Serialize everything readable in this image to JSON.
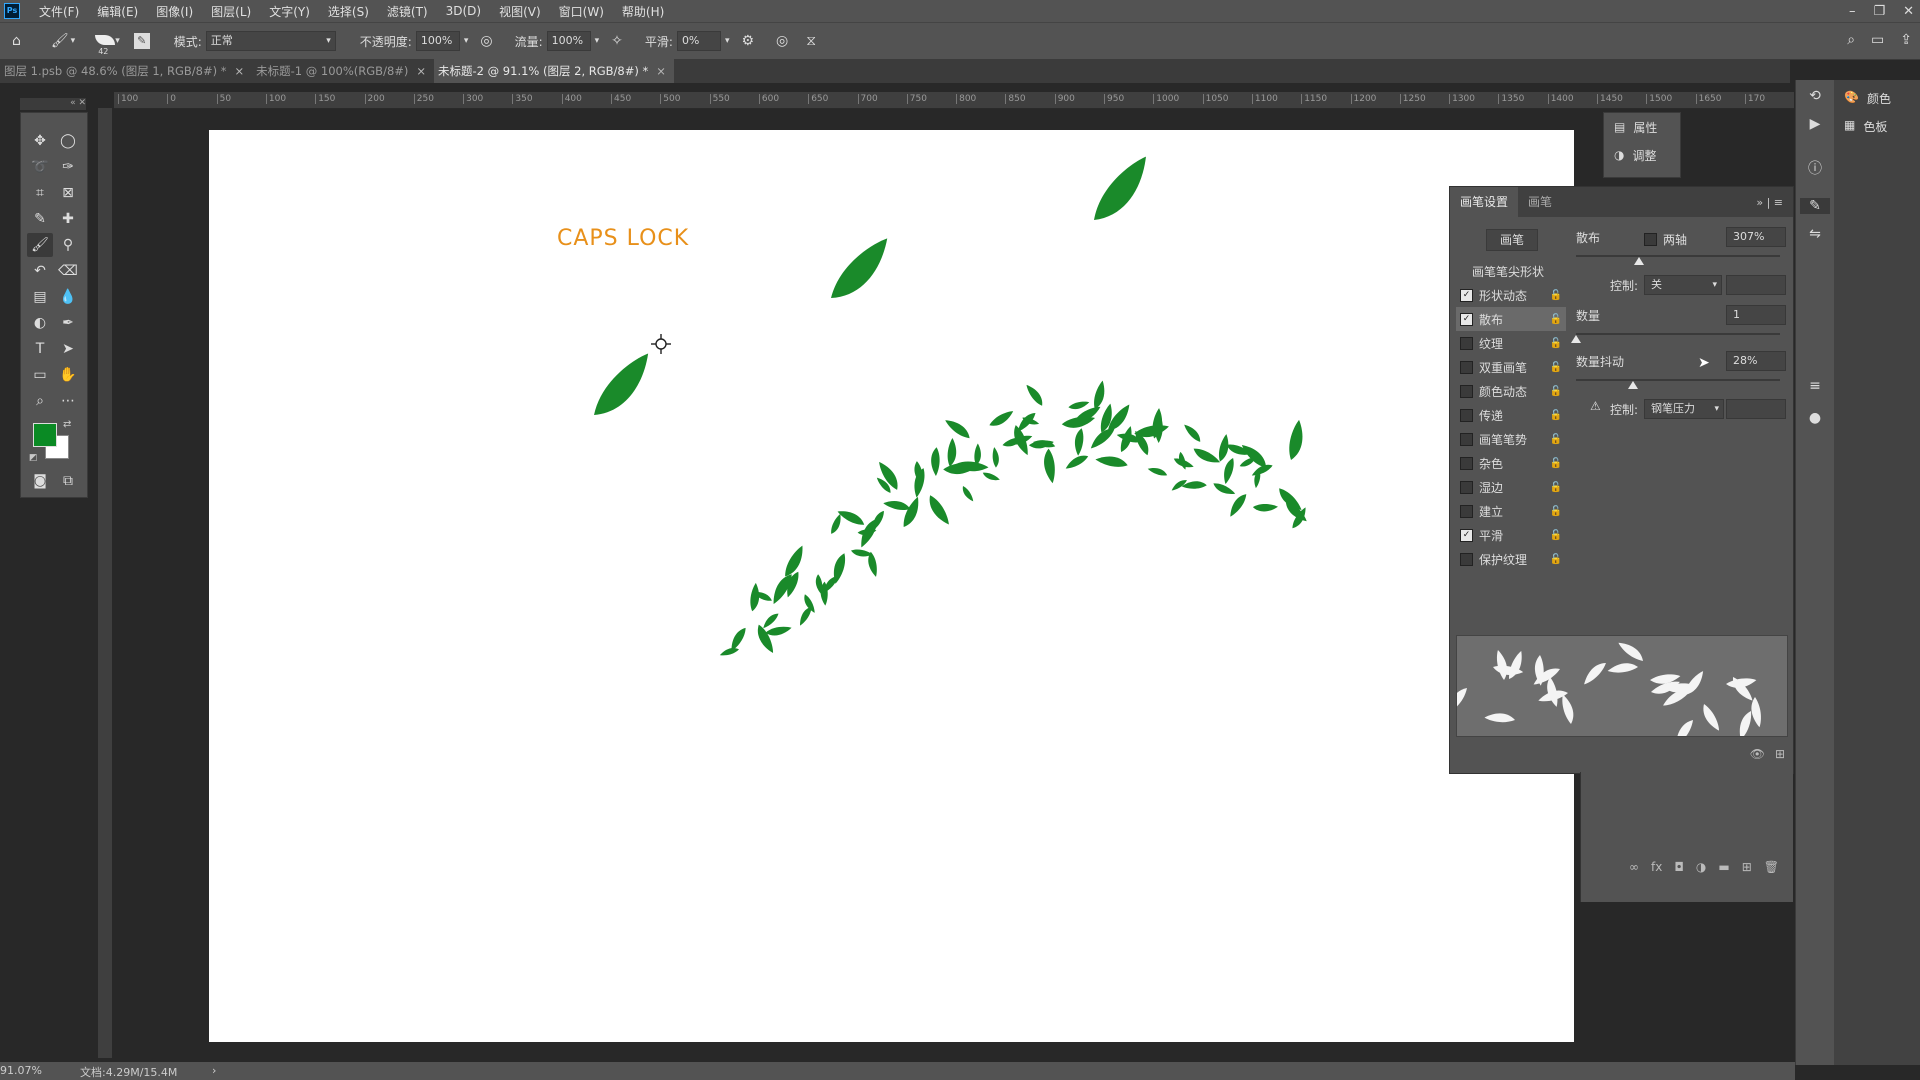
{
  "app": {
    "logo": "Ps"
  },
  "menu": [
    "文件(F)",
    "编辑(E)",
    "图像(I)",
    "图层(L)",
    "文字(Y)",
    "选择(S)",
    "滤镜(T)",
    "3D(D)",
    "视图(V)",
    "窗口(W)",
    "帮助(H)"
  ],
  "options": {
    "brush_size": "42",
    "mode_label": "模式:",
    "mode_value": "正常",
    "opacity_label": "不透明度:",
    "opacity_value": "100%",
    "flow_label": "流量:",
    "flow_value": "100%",
    "smooth_label": "平滑:",
    "smooth_value": "0%"
  },
  "tabs": [
    {
      "label": "图层 1.psb @ 48.6% (图层 1, RGB/8#) *"
    },
    {
      "label": "未标题-1 @ 100%(RGB/8#)"
    },
    {
      "label": "未标题-2 @ 91.1% (图层 2, RGB/8#) *"
    }
  ],
  "ruler_marks": [
    "100",
    "0",
    "50",
    "100",
    "150",
    "200",
    "250",
    "300",
    "350",
    "400",
    "450",
    "500",
    "550",
    "600",
    "650",
    "700",
    "750",
    "800",
    "850",
    "900",
    "950",
    "1000",
    "1050",
    "1100",
    "1150",
    "1200",
    "1250",
    "1300",
    "1350",
    "1400",
    "1450",
    "1500",
    "1650",
    "170"
  ],
  "canvas": {
    "caps_text": "CAPS LOCK"
  },
  "colors": {
    "foreground": "#0a8a24",
    "background": "#ffffff",
    "leaf": "#1a8a2a",
    "caps": "#e8901a"
  },
  "props_popout": {
    "properties": "属性",
    "adjustments": "调整"
  },
  "right_dock": {
    "color": "颜色",
    "swatches": "色板"
  },
  "brush_panel": {
    "tab_settings": "画笔设置",
    "tab_brush": "画笔",
    "brush_button": "画笔",
    "tip_shape": "画笔笔尖形状",
    "items": [
      {
        "label": "形状动态",
        "checked": true
      },
      {
        "label": "散布",
        "checked": true,
        "selected": true
      },
      {
        "label": "纹理",
        "checked": false
      },
      {
        "label": "双重画笔",
        "checked": false
      },
      {
        "label": "颜色动态",
        "checked": false
      },
      {
        "label": "传递",
        "checked": false
      },
      {
        "label": "画笔笔势",
        "checked": false
      },
      {
        "label": "杂色",
        "checked": false
      },
      {
        "label": "湿边",
        "checked": false
      },
      {
        "label": "建立",
        "checked": false
      },
      {
        "label": "平滑",
        "checked": true
      },
      {
        "label": "保护纹理",
        "checked": false
      }
    ],
    "scatter_label": "散布",
    "both_axes": "两轴",
    "scatter_value": "307%",
    "scatter_level": 0.31,
    "control1_label": "控制:",
    "control1_value": "关",
    "count_label": "数量",
    "count_value": "1",
    "count_level": 0.0,
    "count_jitter_label": "数量抖动",
    "count_jitter_value": "28%",
    "count_jitter_level": 0.28,
    "control2_label": "控制:",
    "control2_value": "钢笔压力"
  },
  "status": {
    "zoom": "91.07%",
    "doc": "文档:4.29M/15.4M"
  }
}
